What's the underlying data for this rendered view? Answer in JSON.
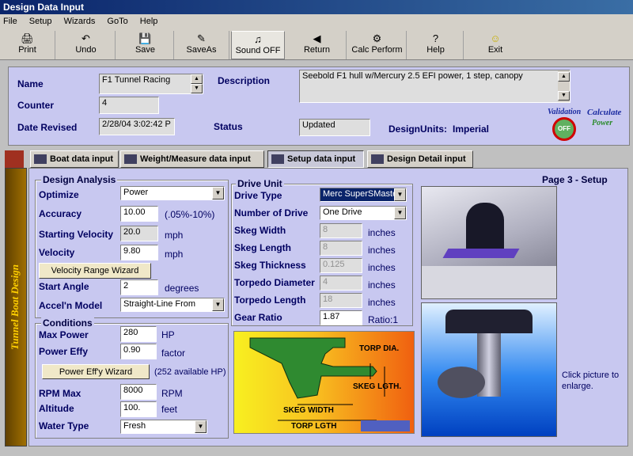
{
  "window": {
    "title": "Design Data Input"
  },
  "menu": [
    "File",
    "Setup",
    "Wizards",
    "GoTo",
    "Help"
  ],
  "toolbar": [
    {
      "label": "Print",
      "icon": "printer-icon"
    },
    {
      "label": "Undo",
      "icon": "undo-icon"
    },
    {
      "label": "Save",
      "icon": "floppy-icon"
    },
    {
      "label": "SaveAs",
      "icon": "save-as-icon"
    },
    {
      "label": "Sound OFF",
      "icon": "sound-icon"
    },
    {
      "label": "Return",
      "icon": "return-icon"
    },
    {
      "label": "Calc Perform",
      "icon": "calc-perform-icon"
    },
    {
      "label": "Help",
      "icon": "help-icon"
    },
    {
      "label": "Exit",
      "icon": "smiley-exit-icon"
    }
  ],
  "header": {
    "name_label": "Name",
    "name_value": "F1 Tunnel Racing",
    "description_label": "Description",
    "description_value": "Seebold F1 hull w/Mercury 2.5 EFI power, 1 step, canopy",
    "counter_label": "Counter",
    "counter_value": "4",
    "date_label": "Date Revised",
    "date_value": "2/28/04 3:02:42 P",
    "status_label": "Status",
    "status_value": "Updated",
    "design_units_label": "DesignUnits:",
    "design_units_value": "Imperial",
    "validation_label": "Validation",
    "validation_state": "OFF",
    "calculate_label": "Calculate",
    "calculate_sub": "Power"
  },
  "sidebar": {
    "label": "Tunnel Boat Design"
  },
  "tabs": [
    {
      "label": "Boat data input"
    },
    {
      "label": "Weight/Measure data input"
    },
    {
      "label": "Setup data input"
    },
    {
      "label": "Design Detail input"
    }
  ],
  "page_label": "Page 3 - Setup",
  "design_analysis": {
    "title": "Design Analysis",
    "optimize_label": "Optimize",
    "optimize_value": "Power",
    "accuracy_label": "Accuracy",
    "accuracy_value": "10.00",
    "accuracy_unit": "(.05%-10%)",
    "start_vel_label": "Starting Velocity",
    "start_vel_value": "20.0",
    "start_vel_unit": "mph",
    "velocity_label": "Velocity",
    "velocity_value": "9.80",
    "velocity_unit": "mph",
    "vel_wizard": "Velocity Range Wizard",
    "start_angle_label": "Start Angle",
    "start_angle_value": "2",
    "start_angle_unit": "degrees",
    "accel_label": "Accel'n Model",
    "accel_value": "Straight-Line From"
  },
  "conditions": {
    "title": "Conditions",
    "max_power_label": "Max Power",
    "max_power_value": "280",
    "max_power_unit": "HP",
    "power_effy_label": "Power Effy",
    "power_effy_value": "0.90",
    "power_effy_unit": "factor",
    "effy_wizard": "Power Eff'y Wizard",
    "effy_note": "(252 available HP)",
    "rpm_label": "RPM Max",
    "rpm_value": "8000",
    "rpm_unit": "RPM",
    "altitude_label": "Altitude",
    "altitude_value": "100.",
    "altitude_unit": "feet",
    "water_label": "Water Type",
    "water_value": "Fresh"
  },
  "drive_unit": {
    "title": "Drive Unit",
    "drive_type_label": "Drive Type",
    "drive_type_value": "Merc SuperSMaste",
    "num_drive_label": "Number of Drive",
    "num_drive_value": "One Drive",
    "skeg_width_label": "Skeg Width",
    "skeg_width_value": "8",
    "skeg_width_unit": "inches",
    "skeg_length_label": "Skeg Length",
    "skeg_length_value": "8",
    "skeg_length_unit": "inches",
    "skeg_thick_label": "Skeg Thickness",
    "skeg_thick_value": "0.125",
    "skeg_thick_unit": "inches",
    "torp_dia_label": "Torpedo Diameter",
    "torp_dia_value": "4",
    "torp_dia_unit": "inches",
    "torp_len_label": "Torpedo Length",
    "torp_len_value": "18",
    "torp_len_unit": "inches",
    "gear_label": "Gear Ratio",
    "gear_value": "1.87",
    "gear_unit": "Ratio:1"
  },
  "diagram": {
    "torp_dia": "TORP DIA.",
    "skeg_lgth": "SKEG LGTH.",
    "skeg_width": "SKEG WIDTH",
    "torp_lgth": "TORP LGTH"
  },
  "enlarge_hint": "Click picture to enlarge.",
  "colors": {
    "panel": "#c8c8f0",
    "title_text": "#000060",
    "titlebar": "#0a246a"
  }
}
